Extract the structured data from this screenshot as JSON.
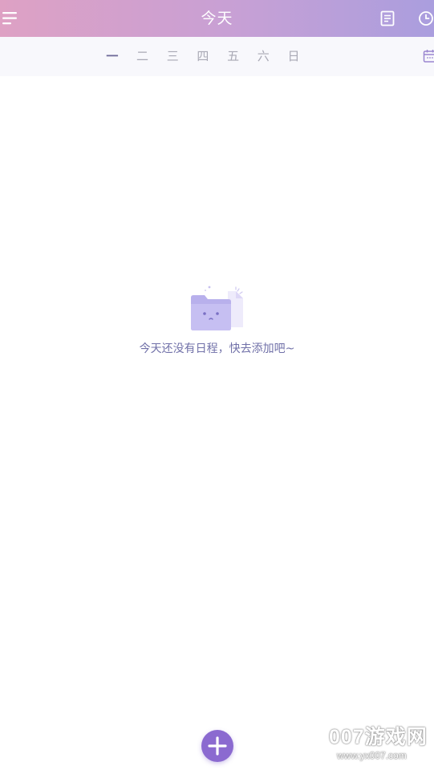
{
  "header": {
    "title": "今天",
    "menu_icon": "menu-icon",
    "notes_icon": "notes-icon",
    "clock_icon": "clock-icon"
  },
  "weekbar": {
    "days": [
      "一",
      "二",
      "三",
      "四",
      "五",
      "六",
      "日"
    ],
    "active_index": 0,
    "calendar_icon": "calendar-icon"
  },
  "empty_state": {
    "icon": "empty-folder-icon",
    "message": "今天还没有日程，快去添加吧~"
  },
  "fab": {
    "icon": "plus-icon"
  },
  "watermark": {
    "main": "007游戏网",
    "sub": "www.yx007.com"
  },
  "colors": {
    "header_gradient_start": "#dea1c4",
    "header_gradient_end": "#aa9ede",
    "accent": "#8b6ad0",
    "empty_text": "#7070a8",
    "inactive_day": "#a9a9b5",
    "active_day": "#6e6a98"
  }
}
